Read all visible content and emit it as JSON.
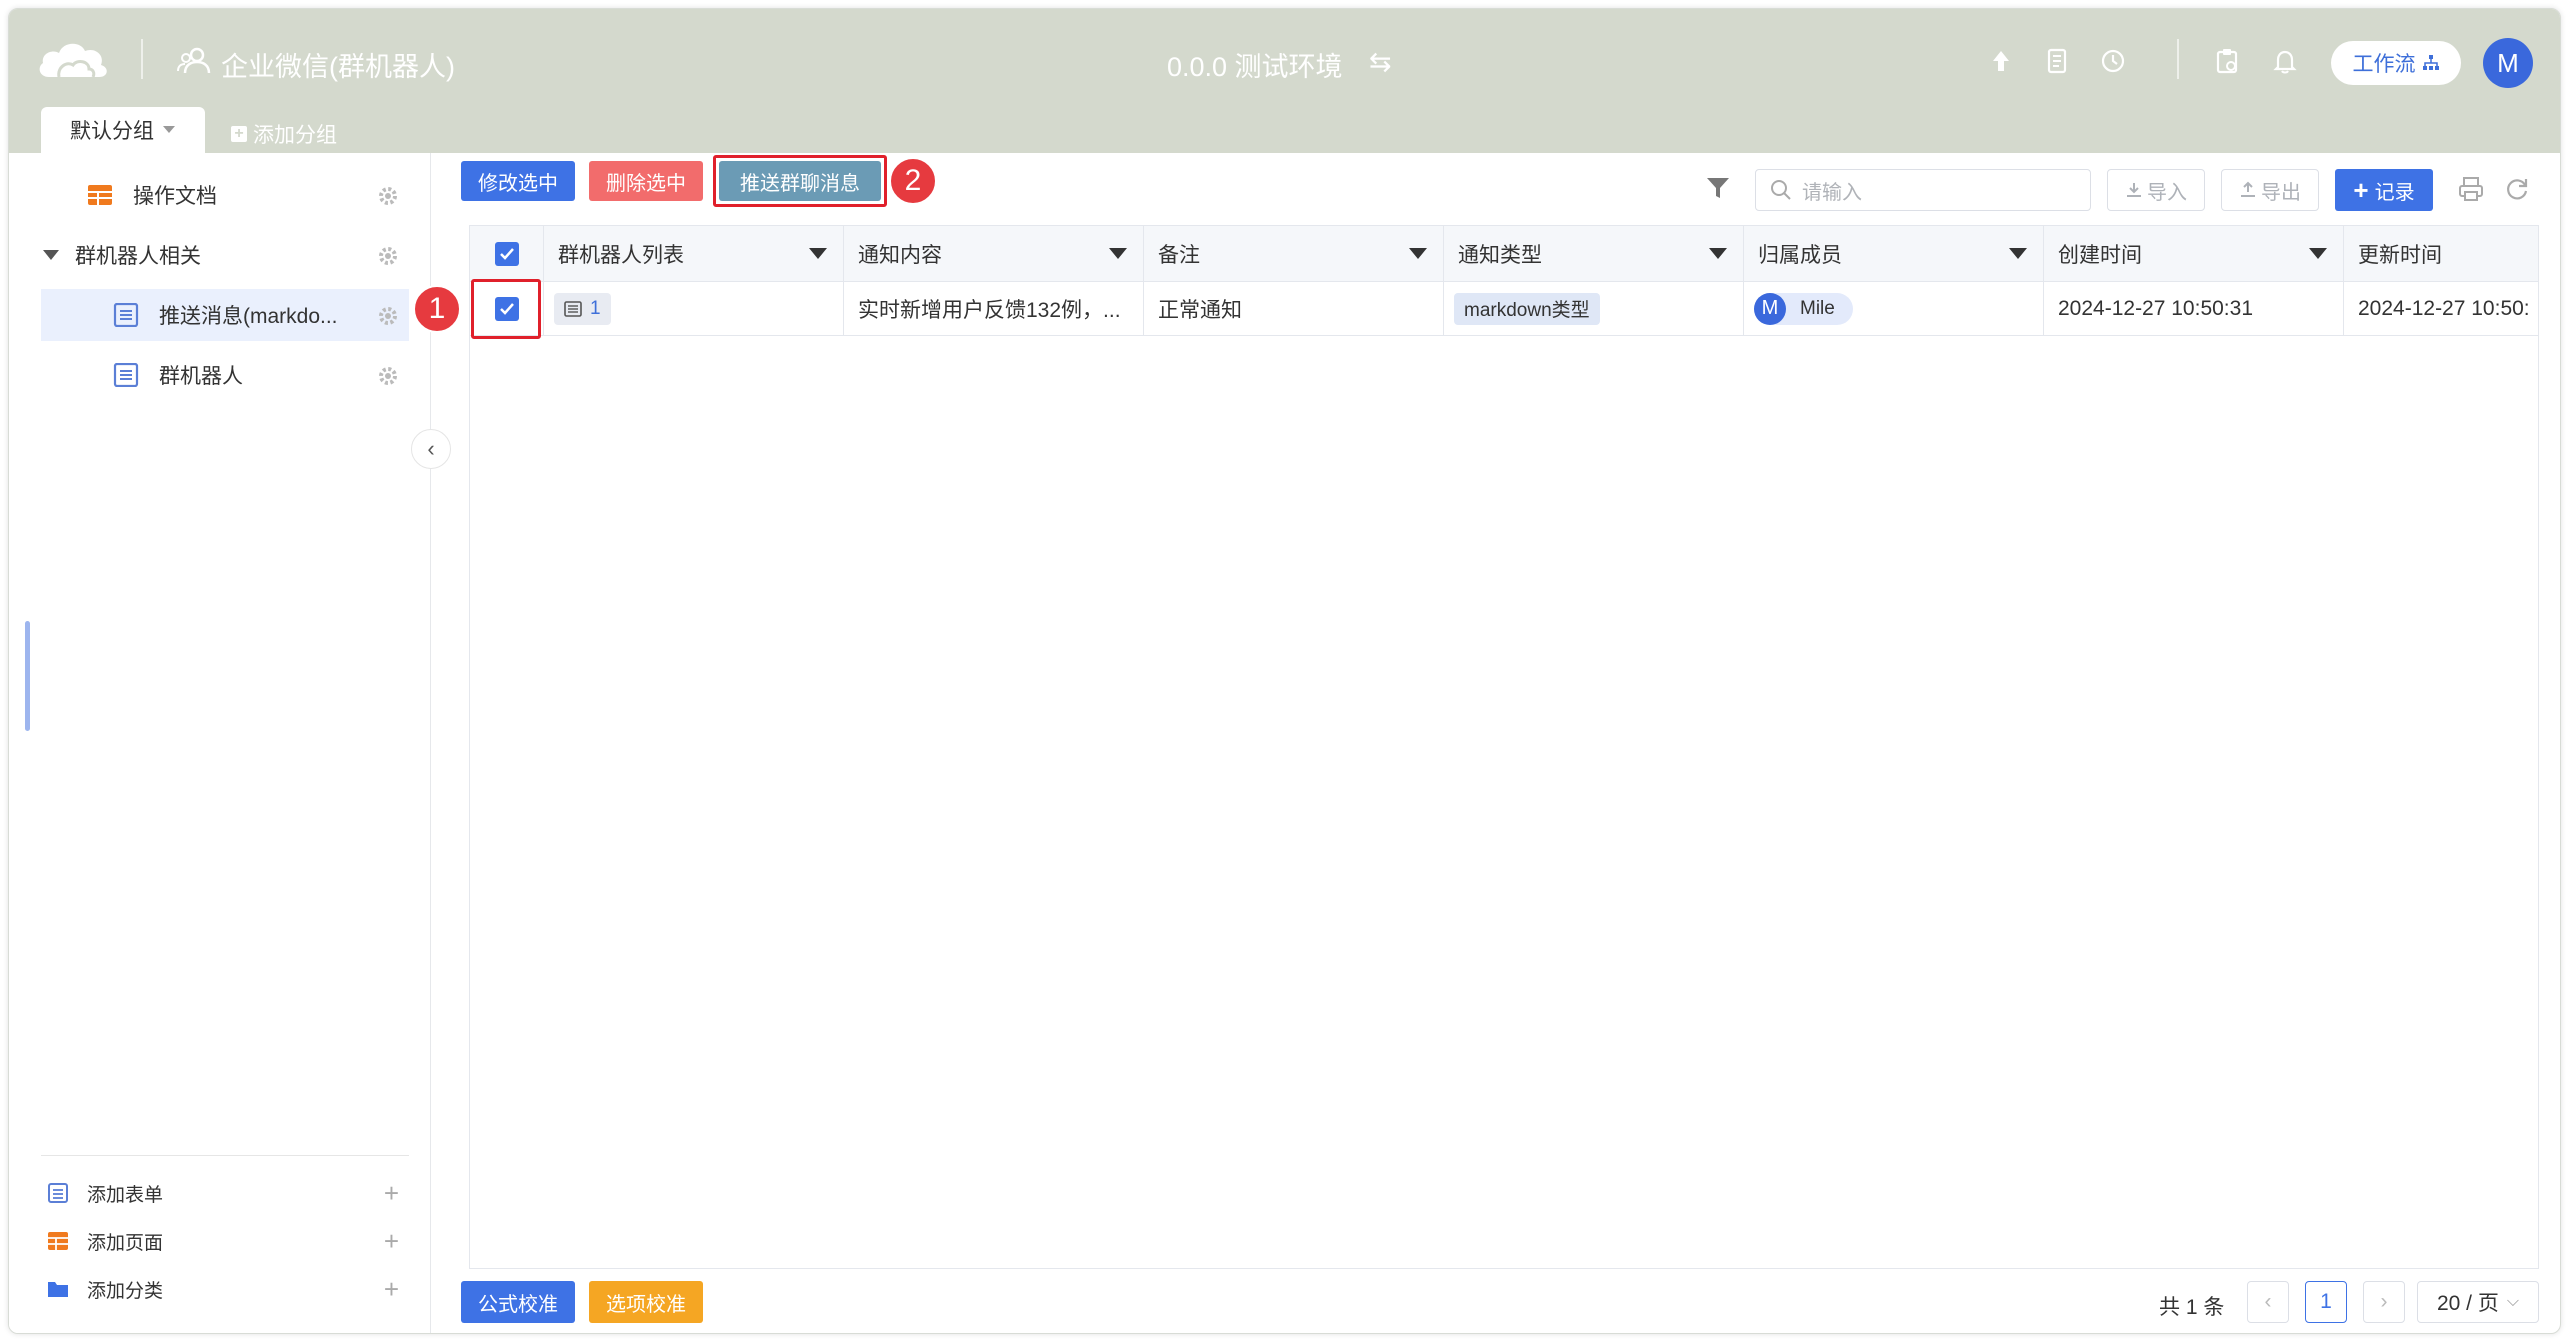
{
  "header": {
    "app_title": "企业微信(群机器人)",
    "env_title": "0.0.0 测试环境",
    "env_switch_glyph": "⇆",
    "workflow_label": "工作流",
    "user_initial": "M",
    "icons": [
      "upload-icon",
      "document-icon",
      "history-icon",
      "clipboard-icon",
      "bell-icon"
    ]
  },
  "tabs": {
    "active_label": "默认分组",
    "add_label": "添加分组"
  },
  "sidebar": {
    "items": [
      {
        "label": "操作文档",
        "icon": "table-icon"
      },
      {
        "label": "群机器人相关",
        "icon": "folder-caret-icon"
      },
      {
        "label": "推送消息(markdo...",
        "icon": "form-icon",
        "active": true
      },
      {
        "label": "群机器人",
        "icon": "form-icon"
      }
    ],
    "add_items": [
      {
        "label": "添加表单",
        "icon": "form-icon"
      },
      {
        "label": "添加页面",
        "icon": "table-icon"
      },
      {
        "label": "添加分类",
        "icon": "folder-icon"
      }
    ],
    "collapse_glyph": "‹"
  },
  "toolbar": {
    "edit_selected": "修改选中",
    "delete_selected": "删除选中",
    "push_group": "推送群聊消息",
    "search_placeholder": "请输入",
    "import": "导入",
    "export": "导出",
    "add_record": "记录",
    "add_record_plus": "+"
  },
  "annotations": [
    "1",
    "2"
  ],
  "table": {
    "columns": [
      "群机器人列表",
      "通知内容",
      "备注",
      "通知类型",
      "归属成员",
      "创建时间",
      "更新时间"
    ],
    "rows": [
      {
        "robot_count": "1",
        "content": "实时新增用户反馈132例，...",
        "remark": "正常通知",
        "type": "markdown类型",
        "member_initial": "M",
        "member": "Mile",
        "created": "2024-12-27 10:50:31",
        "updated": "2024-12-27 10:50:"
      }
    ]
  },
  "footer": {
    "formula_check": "公式校准",
    "option_check": "选项校准",
    "total": "共 1 条",
    "current_page": "1",
    "prev_glyph": "‹",
    "next_glyph": "›",
    "page_size": "20 / 页",
    "page_size_caret": "⌵"
  },
  "colors": {
    "header_bg": "#d4d9cd",
    "primary": "#3e72e5",
    "danger": "#f26c6c",
    "push_btn": "#6b9bb5",
    "warning": "#f5a623",
    "annotation_red": "#e63a3f"
  }
}
